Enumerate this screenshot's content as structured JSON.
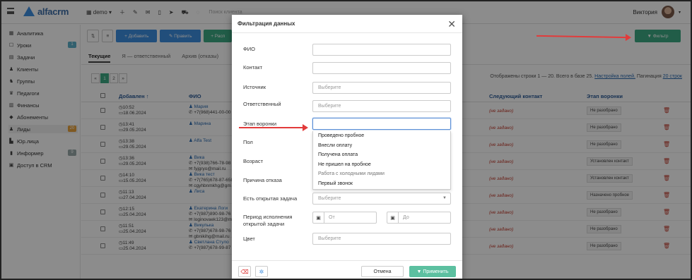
{
  "topbar": {
    "logo": "alfacrm",
    "branch": "demo",
    "search_placeholder": "Поиск клиента",
    "user_name": "Виктория",
    "icons": [
      "plus-icon",
      "wrench-icon",
      "mail-icon",
      "phone-icon",
      "send-icon",
      "cart-icon",
      "circle-icon"
    ]
  },
  "sidebar": {
    "items": [
      {
        "label": "Аналитика",
        "icon": "dashboard-icon",
        "badge": ""
      },
      {
        "label": "Уроки",
        "icon": "calendar-icon",
        "badge": "1"
      },
      {
        "label": "Задачи",
        "icon": "tasks-icon",
        "badge": ""
      },
      {
        "label": "Клиенты",
        "icon": "user-icon",
        "badge": ""
      },
      {
        "label": "Группы",
        "icon": "group-icon",
        "badge": ""
      },
      {
        "label": "Педагоги",
        "icon": "teacher-icon",
        "badge": ""
      },
      {
        "label": "Финансы",
        "icon": "money-icon",
        "badge": ""
      },
      {
        "label": "Абонементы",
        "icon": "tag-icon",
        "badge": ""
      },
      {
        "label": "Лиды",
        "icon": "leads-icon",
        "badge": "20"
      },
      {
        "label": "Юр.лица",
        "icon": "building-icon",
        "badge": ""
      },
      {
        "label": "Информер",
        "icon": "chart-icon",
        "badge": "9"
      },
      {
        "label": "Доступ в CRM",
        "icon": "lock-icon",
        "badge": ""
      }
    ]
  },
  "toolbar": {
    "add_label": "Добавить",
    "edit_label": "Править",
    "third_label": "Расп",
    "filter_label": "Фильтр"
  },
  "tabs": [
    "Текущие",
    "Я — ответственный",
    "Архив (отказы)"
  ],
  "pager": {
    "pages": [
      "«",
      "1",
      "2",
      "»"
    ]
  },
  "rows_info": {
    "text": "Отображены строки 1 — 20. Всего в базе 25.",
    "fields_link": "Настройка полей.",
    "pagination_text": "Пагинация",
    "pagination_link": "20 строк"
  },
  "table": {
    "headers": {
      "added": "Добавлен ↑",
      "name": "ФИО",
      "next_contact": "Следующий контакт",
      "stage": "Этап воронки"
    },
    "rows": [
      {
        "time": "10:52",
        "date": "18.06.2024",
        "name": "Мария",
        "sub": "+7(968)441-00-00",
        "next": "(не задано)",
        "stage": "Не разобрано"
      },
      {
        "time": "13:41",
        "date": "29.05.2024",
        "name": "Марина",
        "sub": "",
        "next": "(не задано)",
        "stage": "Не разобрано"
      },
      {
        "time": "13:38",
        "date": "29.05.2024",
        "name": "Alfa Test",
        "sub": "",
        "next": "(не задано)",
        "stage": "Не разобрано"
      },
      {
        "time": "13:36",
        "date": "29.05.2024",
        "name": "Вика",
        "sub": "+7(938)766-78-98",
        "sub2": "fyjgryo@mail.ru",
        "next": "(не задано)",
        "stage": "Установлен контакт"
      },
      {
        "time": "14:10",
        "date": "15.05.2024",
        "name": "Вика тест",
        "sub": "+7(765)678-87-658",
        "sub2": "cgyhbnmkhg@gm",
        "next": "(не задано)",
        "stage": "Установлен контакт"
      },
      {
        "time": "11:13",
        "date": "27.04.2024",
        "name": "Лиса",
        "sub": "",
        "next": "(не задано)",
        "stage": "Назначено пробное"
      },
      {
        "time": "12:15",
        "date": "25.04.2024",
        "name": "Екатерина Логи",
        "sub": "+7(987)890-98-76",
        "sub2": "loginovaek123@m",
        "next": "(не задано)",
        "stage": "Не разобрано"
      },
      {
        "time": "11:51",
        "date": "25.04.2024",
        "name": "Викулька",
        "sub": "+7(987)678-98-76",
        "sub2": "gbnikihg@mail.ru",
        "next": "(не задано)",
        "stage": "Не разобрано"
      },
      {
        "time": "11:49",
        "date": "25.04.2024",
        "name": "Светлана Стуло",
        "sub": "+7(987)678-99-87",
        "next": "(не задано)",
        "stage": "Не разобрано"
      }
    ]
  },
  "modal": {
    "title": "Фильтрация данных",
    "fields": [
      {
        "label": "ФИО",
        "placeholder": ""
      },
      {
        "label": "Контакт",
        "placeholder": ""
      },
      {
        "label": "Источник",
        "placeholder": "Выберите"
      },
      {
        "label": "Ответственный",
        "placeholder": "Выберите"
      },
      {
        "label": "Этап воронки",
        "placeholder": ""
      },
      {
        "label": "Пол",
        "placeholder": ""
      },
      {
        "label": "Возраст",
        "placeholder": ""
      },
      {
        "label": "Причина отказа",
        "placeholder": ""
      },
      {
        "label": "Есть открытая задача",
        "placeholder": "Выберите"
      },
      {
        "label": "Период исполнения открытой задачи",
        "placeholder": ""
      },
      {
        "label": "Цвет",
        "placeholder": "Выберите"
      }
    ],
    "date_from": "От",
    "date_to": "До",
    "dropdown_options": [
      "Проведено пробное",
      "Внесли оплату",
      "Получена оплата",
      "Не пришел на пробное",
      "Работа с холодными лидами",
      "Первый звонок"
    ],
    "cancel_label": "Отмена",
    "apply_label": "Применить"
  },
  "colors": {
    "accent": "#3daa84",
    "link": "#2a6ab0",
    "danger": "#c0392b",
    "primary": "#3d8ee0"
  }
}
